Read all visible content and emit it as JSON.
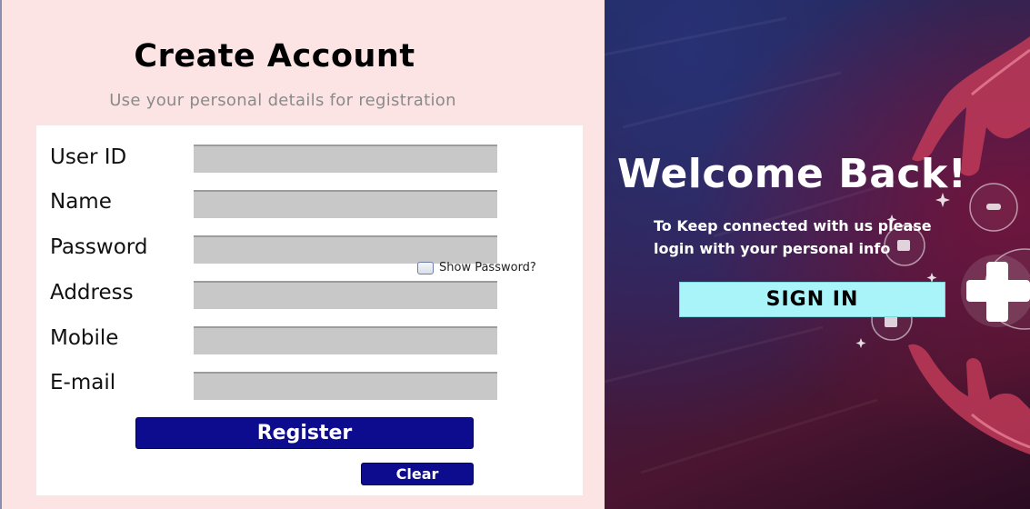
{
  "register": {
    "title": "Create Account",
    "subtitle": "Use your personal details for registration",
    "fields": [
      {
        "label": "User ID",
        "value": ""
      },
      {
        "label": "Name",
        "value": ""
      },
      {
        "label": "Password",
        "value": ""
      },
      {
        "label": "Address",
        "value": ""
      },
      {
        "label": "Mobile",
        "value": ""
      },
      {
        "label": "E-mail",
        "value": ""
      }
    ],
    "show_password_label": "Show Password?",
    "show_password_checked": false,
    "register_label": "Register",
    "clear_label": "Clear"
  },
  "welcome": {
    "title": "Welcome Back!",
    "tagline_line1": "To Keep connected with us please",
    "tagline_line2": "login with your personal info",
    "signin_label": "SIGN IN"
  },
  "colors": {
    "left_bg": "#fde4e4",
    "button_bg": "#0e0c8e",
    "signin_bg": "#a8f4f8"
  }
}
